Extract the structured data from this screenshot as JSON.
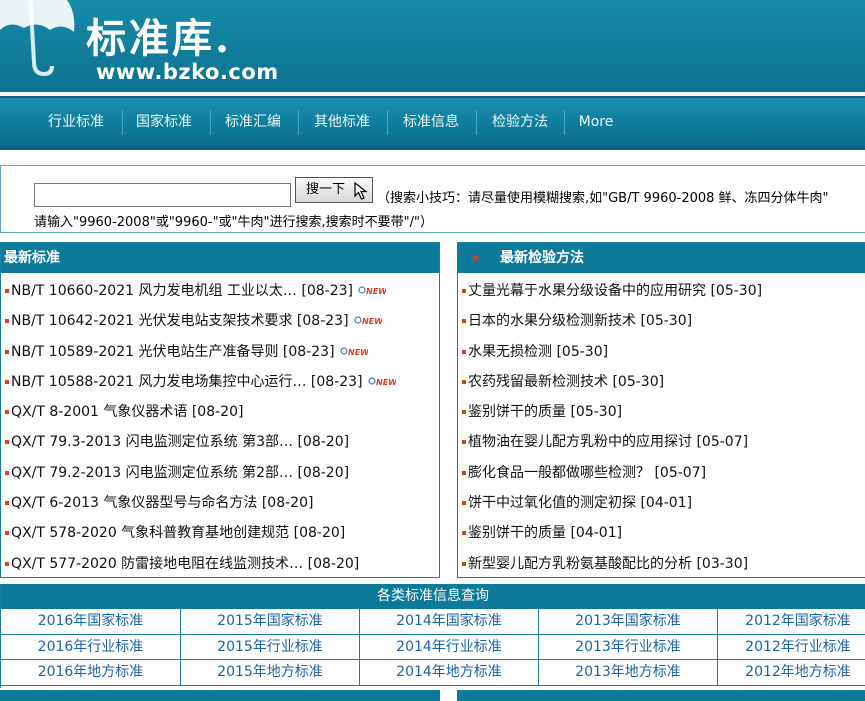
{
  "header": {
    "logo_title": "标准库",
    "logo_dot": ".",
    "logo_url": "www.bzko.com",
    "colors": {
      "header_bg": "#0e7d9b",
      "accent": "#0d7a99",
      "bullet": "#e23b1c",
      "link": "#1c62a8"
    }
  },
  "nav": {
    "items": [
      "行业标准",
      "国家标准",
      "标准汇编",
      "其他标准",
      "标准信息",
      "检验方法",
      "More"
    ]
  },
  "search": {
    "input_value": "",
    "button_label": "搜一下",
    "tip_line1": "（搜索小技巧：请尽量使用模糊搜索,如\"GB/T 9960-2008 鲜、冻四分体牛肉\"",
    "tip_line2": "请输入\"9960-2008\"或\"9960-\"或\"牛肉\"进行搜索,搜索时不要带\"/\"）"
  },
  "latest_standards": {
    "title": "最新标准",
    "items": [
      {
        "text": "NB/T 10660-2021 风力发电机组 工业以太…",
        "date": "[08-23]",
        "new": true,
        "new_label": "NEW"
      },
      {
        "text": "NB/T 10642-2021 光伏发电站支架技术要求",
        "date": "[08-23]",
        "new": true,
        "new_label": "NEW"
      },
      {
        "text": "NB/T 10589-2021 光伏电站生产准备导则",
        "date": "[08-23]",
        "new": true,
        "new_label": "NEW"
      },
      {
        "text": "NB/T 10588-2021 风力发电场集控中心运行…",
        "date": "[08-23]",
        "new": true,
        "new_label": "NEW"
      },
      {
        "text": "QX/T 8-2001 气象仪器术语",
        "date": "[08-20]",
        "new": false
      },
      {
        "text": "QX/T 79.3-2013 闪电监测定位系统 第3部…",
        "date": "[08-20]",
        "new": false
      },
      {
        "text": "QX/T 79.2-2013 闪电监测定位系统 第2部…",
        "date": "[08-20]",
        "new": false
      },
      {
        "text": "QX/T 6-2013 气象仪器型号与命名方法",
        "date": "[08-20]",
        "new": false
      },
      {
        "text": "QX/T 578-2020 气象科普教育基地创建规范",
        "date": "[08-20]",
        "new": false
      },
      {
        "text": "QX/T 577-2020 防雷接地电阻在线监测技术…",
        "date": "[08-20]",
        "new": false
      }
    ]
  },
  "latest_methods": {
    "title": "最新检验方法",
    "items": [
      {
        "text": "丈量光幕于水果分级设备中的应用研究",
        "date": "[05-30]"
      },
      {
        "text": "日本的水果分级检测新技术",
        "date": "[05-30]"
      },
      {
        "text": "水果无损检测",
        "date": "[05-30]"
      },
      {
        "text": "农药残留最新检测技术",
        "date": "[05-30]"
      },
      {
        "text": "鉴别饼干的质量",
        "date": "[05-30]"
      },
      {
        "text": "植物油在婴儿配方乳粉中的应用探讨",
        "date": "[05-07]"
      },
      {
        "text": "膨化食品一般都做哪些检测？",
        "date": "[05-07]"
      },
      {
        "text": "饼干中过氧化值的测定初探",
        "date": "[04-01]"
      },
      {
        "text": "鉴别饼干的质量",
        "date": "[04-01]"
      },
      {
        "text": "新型婴儿配方乳粉氨基酸配比的分析",
        "date": "[03-30]"
      }
    ]
  },
  "categories": {
    "title": "各类标准信息查询",
    "rows": [
      [
        "2016年国家标准",
        "2015年国家标准",
        "2014年国家标准",
        "2013年国家标准",
        "2012年国家标准"
      ],
      [
        "2016年行业标准",
        "2015年行业标准",
        "2014年行业标准",
        "2013年行业标准",
        "2012年行业标准"
      ],
      [
        "2016年地方标准",
        "2015年地方标准",
        "2014年地方标准",
        "2013年地方标准",
        "2012年地方标准"
      ]
    ]
  }
}
